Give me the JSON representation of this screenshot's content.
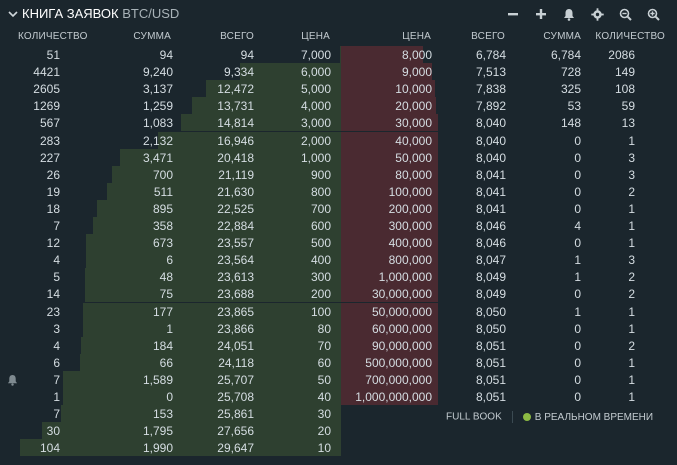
{
  "header": {
    "title": "КНИГА ЗАЯВОК",
    "pair": "BTC/USD",
    "icons": [
      "minus-icon",
      "plus-icon",
      "bell-icon",
      "gear-icon",
      "zoom-out-icon",
      "zoom-in-icon"
    ]
  },
  "columns": {
    "bid_qty": "КОЛИЧЕСТВО",
    "bid_sum": "СУММА",
    "bid_total": "ВСЕГО",
    "bid_price": "ЦЕНА",
    "ask_price": "ЦЕНА",
    "ask_total": "ВСЕГО",
    "ask_sum": "СУММА",
    "ask_qty": "КОЛИЧЕСТВО"
  },
  "rows": [
    {
      "bid_qty": "51",
      "bid_sum": "94",
      "bid_total": "94",
      "bid_price": "7,000",
      "ask_price": "8,000",
      "ask_total": "6,784",
      "ask_sum": "6,784",
      "ask_qty": "2086"
    },
    {
      "bid_qty": "4421",
      "bid_sum": "9,240",
      "bid_total": "9,334",
      "bid_price": "6,000",
      "ask_price": "9,000",
      "ask_total": "7,513",
      "ask_sum": "728",
      "ask_qty": "149"
    },
    {
      "bid_qty": "2605",
      "bid_sum": "3,137",
      "bid_total": "12,472",
      "bid_price": "5,000",
      "ask_price": "10,000",
      "ask_total": "7,838",
      "ask_sum": "325",
      "ask_qty": "108"
    },
    {
      "bid_qty": "1269",
      "bid_sum": "1,259",
      "bid_total": "13,731",
      "bid_price": "4,000",
      "ask_price": "20,000",
      "ask_total": "7,892",
      "ask_sum": "53",
      "ask_qty": "59"
    },
    {
      "bid_qty": "567",
      "bid_sum": "1,083",
      "bid_total": "14,814",
      "bid_price": "3,000",
      "ask_price": "30,000",
      "ask_total": "8,040",
      "ask_sum": "148",
      "ask_qty": "13"
    },
    {
      "bid_qty": "283",
      "bid_sum": "2,132",
      "bid_total": "16,946",
      "bid_price": "2,000",
      "ask_price": "40,000",
      "ask_total": "8,040",
      "ask_sum": "0",
      "ask_qty": "1"
    },
    {
      "bid_qty": "227",
      "bid_sum": "3,471",
      "bid_total": "20,418",
      "bid_price": "1,000",
      "ask_price": "50,000",
      "ask_total": "8,040",
      "ask_sum": "0",
      "ask_qty": "3"
    },
    {
      "bid_qty": "26",
      "bid_sum": "700",
      "bid_total": "21,119",
      "bid_price": "900",
      "ask_price": "80,000",
      "ask_total": "8,041",
      "ask_sum": "0",
      "ask_qty": "3"
    },
    {
      "bid_qty": "19",
      "bid_sum": "511",
      "bid_total": "21,630",
      "bid_price": "800",
      "ask_price": "100,000",
      "ask_total": "8,041",
      "ask_sum": "0",
      "ask_qty": "2"
    },
    {
      "bid_qty": "18",
      "bid_sum": "895",
      "bid_total": "22,525",
      "bid_price": "700",
      "ask_price": "200,000",
      "ask_total": "8,041",
      "ask_sum": "0",
      "ask_qty": "1"
    },
    {
      "bid_qty": "7",
      "bid_sum": "358",
      "bid_total": "22,884",
      "bid_price": "600",
      "ask_price": "300,000",
      "ask_total": "8,046",
      "ask_sum": "4",
      "ask_qty": "1"
    },
    {
      "bid_qty": "12",
      "bid_sum": "673",
      "bid_total": "23,557",
      "bid_price": "500",
      "ask_price": "400,000",
      "ask_total": "8,046",
      "ask_sum": "0",
      "ask_qty": "1"
    },
    {
      "bid_qty": "4",
      "bid_sum": "6",
      "bid_total": "23,564",
      "bid_price": "400",
      "ask_price": "800,000",
      "ask_total": "8,047",
      "ask_sum": "1",
      "ask_qty": "3"
    },
    {
      "bid_qty": "5",
      "bid_sum": "48",
      "bid_total": "23,613",
      "bid_price": "300",
      "ask_price": "1,000,000",
      "ask_total": "8,049",
      "ask_sum": "1",
      "ask_qty": "2"
    },
    {
      "bid_qty": "14",
      "bid_sum": "75",
      "bid_total": "23,688",
      "bid_price": "200",
      "ask_price": "30,000,000",
      "ask_total": "8,049",
      "ask_sum": "0",
      "ask_qty": "2"
    },
    {
      "bid_qty": "23",
      "bid_sum": "177",
      "bid_total": "23,865",
      "bid_price": "100",
      "ask_price": "50,000,000",
      "ask_total": "8,050",
      "ask_sum": "1",
      "ask_qty": "1"
    },
    {
      "bid_qty": "3",
      "bid_sum": "1",
      "bid_total": "23,866",
      "bid_price": "80",
      "ask_price": "60,000,000",
      "ask_total": "8,050",
      "ask_sum": "0",
      "ask_qty": "1"
    },
    {
      "bid_qty": "4",
      "bid_sum": "184",
      "bid_total": "24,051",
      "bid_price": "70",
      "ask_price": "90,000,000",
      "ask_total": "8,051",
      "ask_sum": "0",
      "ask_qty": "2"
    },
    {
      "bid_qty": "6",
      "bid_sum": "66",
      "bid_total": "24,118",
      "bid_price": "60",
      "ask_price": "500,000,000",
      "ask_total": "8,051",
      "ask_sum": "0",
      "ask_qty": "1"
    },
    {
      "bid_qty": "7",
      "bid_sum": "1,589",
      "bid_total": "25,707",
      "bid_price": "50",
      "ask_price": "700,000,000",
      "ask_total": "8,051",
      "ask_sum": "0",
      "ask_qty": "1"
    },
    {
      "bid_qty": "1",
      "bid_sum": "0",
      "bid_total": "25,708",
      "bid_price": "40",
      "ask_price": "1,000,000,000",
      "ask_total": "8,051",
      "ask_sum": "0",
      "ask_qty": "1"
    },
    {
      "bid_qty": "7",
      "bid_sum": "153",
      "bid_total": "25,861",
      "bid_price": "30",
      "ask_price": "",
      "ask_total": "",
      "ask_sum": "",
      "ask_qty": ""
    },
    {
      "bid_qty": "30",
      "bid_sum": "1,795",
      "bid_total": "27,656",
      "bid_price": "20",
      "ask_price": "",
      "ask_total": "",
      "ask_sum": "",
      "ask_qty": ""
    },
    {
      "bid_qty": "104",
      "bid_sum": "1,990",
      "bid_total": "29,647",
      "bid_price": "10",
      "ask_price": "",
      "ask_total": "",
      "ask_sum": "",
      "ask_qty": ""
    }
  ],
  "depth": {
    "bid_max_total": 29647,
    "ask_max_total": 8051
  },
  "footer": {
    "full_book": "FULL BOOK",
    "realtime": "В РЕАЛЬНОМ ВРЕМЕНИ"
  },
  "colors": {
    "background": "#1b262d",
    "bid_depth": "#2e4030",
    "ask_depth": "#4a2a31",
    "realtime_dot": "#8cba43"
  }
}
